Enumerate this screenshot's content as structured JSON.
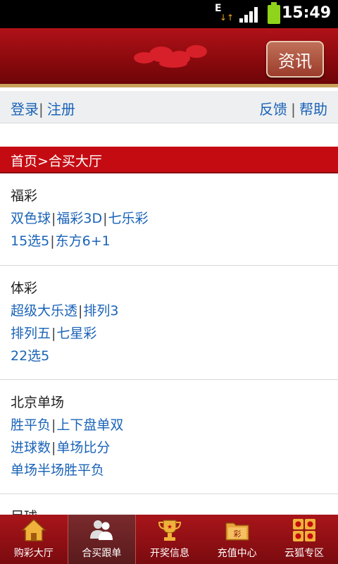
{
  "status_bar": {
    "network": "E",
    "network_arrows": "↓↑",
    "time": "15:49"
  },
  "header": {
    "news_label": "资讯"
  },
  "links": {
    "login": "登录",
    "register": "注册",
    "feedback": "反馈",
    "help": "帮助",
    "separator": "|"
  },
  "breadcrumb": "首页>合买大厅",
  "sections": [
    {
      "title": "福彩",
      "lines": [
        [
          "双色球",
          "福彩3D",
          "七乐彩"
        ],
        [
          "15选5",
          "东方6+1"
        ]
      ]
    },
    {
      "title": "体彩",
      "lines": [
        [
          "超级大乐透",
          "排列3"
        ],
        [
          "排列五",
          "七星彩"
        ],
        [
          "22选5"
        ]
      ]
    },
    {
      "title": "北京单场",
      "lines": [
        [
          "胜平负",
          "上下盘单双"
        ],
        [
          "进球数",
          "单场比分"
        ],
        [
          "单场半场胜平负"
        ]
      ]
    },
    {
      "title": "足球",
      "lines": []
    }
  ],
  "tabs": [
    {
      "label": "购彩大厅",
      "icon": "house-icon",
      "active": false
    },
    {
      "label": "合买跟单",
      "icon": "people-icon",
      "active": true
    },
    {
      "label": "开奖信息",
      "icon": "trophy-icon",
      "active": false
    },
    {
      "label": "充值中心",
      "icon": "folder-icon",
      "active": false
    },
    {
      "label": "云狐专区",
      "icon": "grid-icon",
      "active": false
    }
  ],
  "colors": {
    "brand_red": "#c50b12",
    "link_blue": "#1a63b8",
    "accent_gold": "#c9a25a"
  }
}
